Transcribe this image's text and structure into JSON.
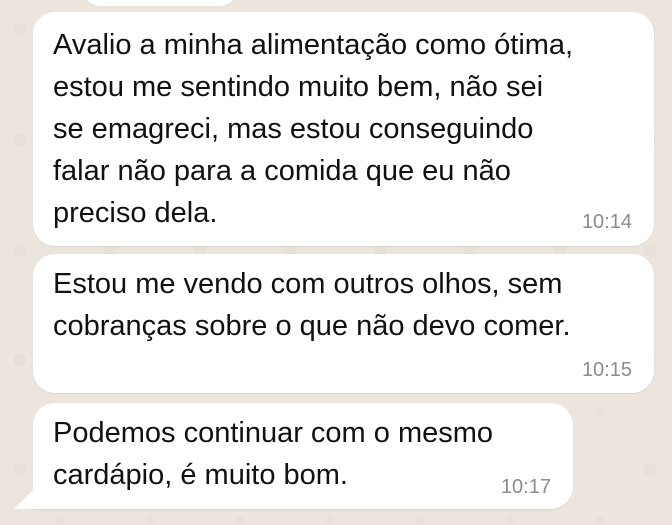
{
  "chat": {
    "messages": [
      {
        "text": "Avalio a minha alimentação como ótima,\nestou me sentindo muito bem, não sei\nse emagreci, mas estou conseguindo\nfalar não para a comida que eu não\npreciso dela.",
        "time": "10:14"
      },
      {
        "text": "Estou me vendo com outros olhos, sem\ncobranças sobre o que não devo comer.",
        "time": "10:15"
      },
      {
        "text": "Podemos continuar com o mesmo\ncardápio, é muito bom.",
        "time": "10:17"
      }
    ]
  },
  "colors": {
    "background": "#ECE5DD",
    "bubble": "#FFFFFF",
    "text": "#111111",
    "timestamp": "#8C8C8C"
  }
}
